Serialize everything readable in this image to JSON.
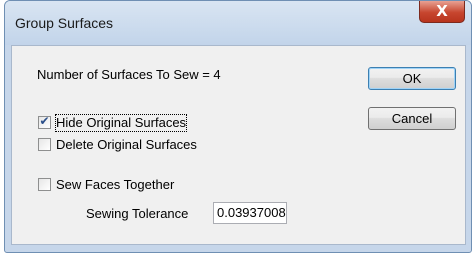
{
  "dialog": {
    "title": "Group Surfaces",
    "close_glyph": "X",
    "surface_count_label": "Number of Surfaces To Sew = 4",
    "ok_label": "OK",
    "cancel_label": "Cancel",
    "options": {
      "hide_original": {
        "label": "Hide Original Surfaces",
        "checked": true
      },
      "delete_original": {
        "label": "Delete Original Surfaces",
        "checked": false
      },
      "sew_faces": {
        "label": "Sew Faces Together",
        "checked": false
      }
    },
    "sewing_tolerance_label": "Sewing Tolerance",
    "sewing_tolerance_value": "0.03937008"
  },
  "icons": {
    "close": "close-icon",
    "check": "checkmark-icon"
  },
  "colors": {
    "frame": "#c6d6ea",
    "close_button": "#c7462f",
    "client": "#f0f0f0",
    "default_button_border": "#3c7fb1"
  }
}
